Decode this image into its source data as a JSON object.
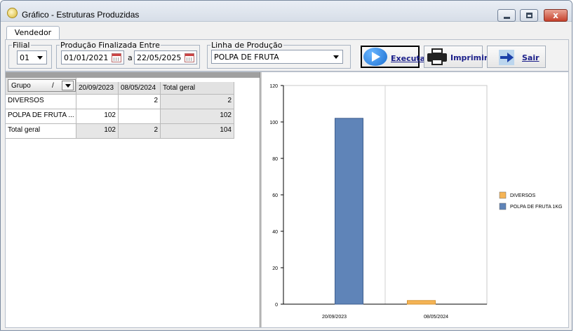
{
  "window": {
    "title": "Gráfico - Estruturas Produzidas",
    "close_glyph": "x",
    "icons": {
      "app": "gear-coin-icon",
      "minimize": "minimize-icon",
      "maximize": "maximize-icon",
      "close": "close-icon"
    }
  },
  "tabs": [
    {
      "label": "Vendedor"
    }
  ],
  "filters": {
    "filial": {
      "legend": "Filial",
      "value": "01"
    },
    "periodo": {
      "legend": "Produção Finalizada Entre",
      "start": "01/01/2021",
      "separator": "a",
      "end": "22/05/2025"
    },
    "linha": {
      "legend": "Linha de Produção",
      "value": "POLPA DE FRUTA"
    }
  },
  "toolbar": {
    "execute_label": "Executa",
    "print_label": "Imprimir",
    "exit_label": "Sair",
    "colors": {
      "label": "#1b1f8a"
    }
  },
  "pivot": {
    "group_field": "Grupo",
    "sort_glyph": "/",
    "columns": [
      "20/09/2023",
      "08/05/2024",
      "Total geral"
    ],
    "rows": [
      {
        "label": "DIVERSOS",
        "values": [
          "",
          "2",
          "2"
        ]
      },
      {
        "label": "POLPA DE FRUTA ...",
        "values": [
          "102",
          "",
          "102"
        ]
      }
    ],
    "total": {
      "label": "Total geral",
      "values": [
        "102",
        "2",
        "104"
      ]
    }
  },
  "chart_data": {
    "type": "bar",
    "categories": [
      "20/09/2023",
      "08/05/2024"
    ],
    "series": [
      {
        "name": "DIVERSOS",
        "color": "#f5b455",
        "values": [
          0,
          2
        ]
      },
      {
        "name": "POLPA DE FRUTA 1KG",
        "color": "#5f84b8",
        "values": [
          102,
          0
        ]
      }
    ],
    "yticks": [
      0,
      20,
      40,
      60,
      80,
      100,
      120
    ],
    "ylim": [
      0,
      120
    ],
    "grid": "vertical lines",
    "legend": "right",
    "title": "",
    "xlabel": "",
    "ylabel": ""
  }
}
